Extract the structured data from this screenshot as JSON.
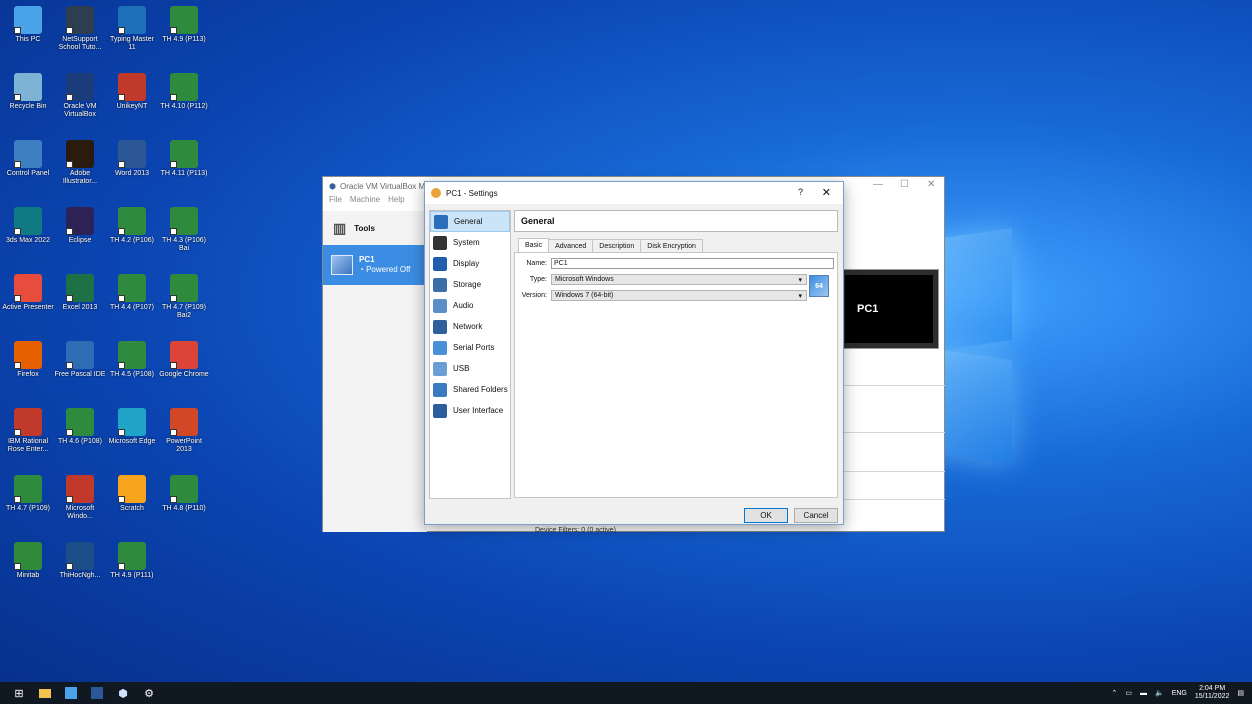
{
  "desktop": {
    "icons": [
      {
        "label": "This PC",
        "icon": "computer-icon",
        "color": "#4aa3e8"
      },
      {
        "label": "NetSupport School Tuto...",
        "icon": "netsupport-icon",
        "color": "#2c3e50"
      },
      {
        "label": "Typing Master 11",
        "icon": "typing-master-icon",
        "color": "#1d6fb8"
      },
      {
        "label": "TH 4.9 (P113)",
        "icon": "excel-file-icon",
        "color": "#2e8b3d"
      },
      {
        "label": "Recycle Bin",
        "icon": "recycle-bin-icon",
        "color": "#7fb3d5"
      },
      {
        "label": "Oracle VM VirtualBox",
        "icon": "virtualbox-icon",
        "color": "#1b3c7a"
      },
      {
        "label": "UnikeyNT",
        "icon": "unikey-icon",
        "color": "#c0392b"
      },
      {
        "label": "TH 4.10 (P112)",
        "icon": "excel-file-icon",
        "color": "#2e8b3d"
      },
      {
        "label": "Control Panel",
        "icon": "control-panel-icon",
        "color": "#3d7fc1"
      },
      {
        "label": "Adobe Illustrator...",
        "icon": "illustrator-icon",
        "color": "#2b1a0e"
      },
      {
        "label": "Word 2013",
        "icon": "word-icon",
        "color": "#2b5797"
      },
      {
        "label": "TH 4.11 (P113)",
        "icon": "excel-file-icon",
        "color": "#2e8b3d"
      },
      {
        "label": "3ds Max 2022",
        "icon": "3dsmax-icon",
        "color": "#0f7a82"
      },
      {
        "label": "Eclipse",
        "icon": "eclipse-icon",
        "color": "#2c2255"
      },
      {
        "label": "TH 4.2 (P106)",
        "icon": "excel-file-icon",
        "color": "#2e8b3d"
      },
      {
        "label": "TH 4.3 (P106) Bai",
        "icon": "excel-file-icon",
        "color": "#2e8b3d"
      },
      {
        "label": "Active Presenter",
        "icon": "active-presenter-icon",
        "color": "#e74c3c"
      },
      {
        "label": "Excel 2013",
        "icon": "excel-icon",
        "color": "#1e7145"
      },
      {
        "label": "TH 4.4 (P107)",
        "icon": "excel-file-icon",
        "color": "#2e8b3d"
      },
      {
        "label": "TH 4.7 (P109) Bai2",
        "icon": "excel-file-icon",
        "color": "#2e8b3d"
      },
      {
        "label": "Firefox",
        "icon": "firefox-icon",
        "color": "#e66000"
      },
      {
        "label": "Free Pascal IDE",
        "icon": "free-pascal-icon",
        "color": "#2e6db4"
      },
      {
        "label": "TH 4.5 (P108)",
        "icon": "excel-file-icon",
        "color": "#2e8b3d"
      },
      {
        "label": "Google Chrome",
        "icon": "chrome-icon",
        "color": "#db4437"
      },
      {
        "label": "IBM Rational Rose Enter...",
        "icon": "rational-rose-icon",
        "color": "#c0392b"
      },
      {
        "label": "TH 4.6 (P108)",
        "icon": "excel-file-icon",
        "color": "#2e8b3d"
      },
      {
        "label": "Microsoft Edge",
        "icon": "edge-icon",
        "color": "#1fa3c7"
      },
      {
        "label": "PowerPoint 2013",
        "icon": "powerpoint-icon",
        "color": "#d24726"
      },
      {
        "label": "TH 4.7 (P109)",
        "icon": "excel-file-icon",
        "color": "#2e8b3d"
      },
      {
        "label": "Microsoft Windo...",
        "icon": "math-icon",
        "color": "#c0392b"
      },
      {
        "label": "Scratch",
        "icon": "scratch-icon",
        "color": "#f7a41d"
      },
      {
        "label": "TH 4.8 (P110)",
        "icon": "excel-file-icon",
        "color": "#2e8b3d"
      },
      {
        "label": "Minitab",
        "icon": "minitab-icon",
        "color": "#2f8a3a"
      },
      {
        "label": "ThiHocNgh...",
        "icon": "exam-icon",
        "color": "#1c4f8a"
      },
      {
        "label": "TH 4.9 (P111)",
        "icon": "excel-file-icon",
        "color": "#2e8b3d"
      }
    ]
  },
  "manager": {
    "title": "Oracle VM VirtualBox M",
    "menu": [
      "File",
      "Machine",
      "Help"
    ],
    "tools_label": "Tools",
    "vm": {
      "name": "PC1",
      "state": "Powered Off"
    },
    "preview_label": "PC1",
    "filters_text": "Device Filters:   0 (0 active)"
  },
  "dialog": {
    "title": "PC1 - Settings",
    "help": "?",
    "close": "✕",
    "categories": [
      {
        "label": "General",
        "icon": "general-icon",
        "color": "#2a6ebb"
      },
      {
        "label": "System",
        "icon": "system-icon",
        "color": "#333333"
      },
      {
        "label": "Display",
        "icon": "display-icon",
        "color": "#1f5fae"
      },
      {
        "label": "Storage",
        "icon": "storage-icon",
        "color": "#3b6ea8"
      },
      {
        "label": "Audio",
        "icon": "audio-icon",
        "color": "#5b8fc7"
      },
      {
        "label": "Network",
        "icon": "network-icon",
        "color": "#2f5f9a"
      },
      {
        "label": "Serial Ports",
        "icon": "serial-ports-icon",
        "color": "#4a90d9"
      },
      {
        "label": "USB",
        "icon": "usb-icon",
        "color": "#6a9fd6"
      },
      {
        "label": "Shared Folders",
        "icon": "shared-folders-icon",
        "color": "#3a7ac2"
      },
      {
        "label": "User Interface",
        "icon": "user-interface-icon",
        "color": "#2a5d9a"
      }
    ],
    "section_title": "General",
    "tabs": [
      "Basic",
      "Advanced",
      "Description",
      "Disk Encryption"
    ],
    "fields": {
      "name_label": "Name:",
      "name_value": "PC1",
      "type_label": "Type:",
      "type_value": "Microsoft Windows",
      "version_label": "Version:",
      "version_value": "Windows 7 (64-bit)"
    },
    "ok": "OK",
    "cancel": "Cancel"
  },
  "taskbar": {
    "tray_lang": "ENG",
    "time": "2:04 PM",
    "date": "15/11/2022"
  }
}
